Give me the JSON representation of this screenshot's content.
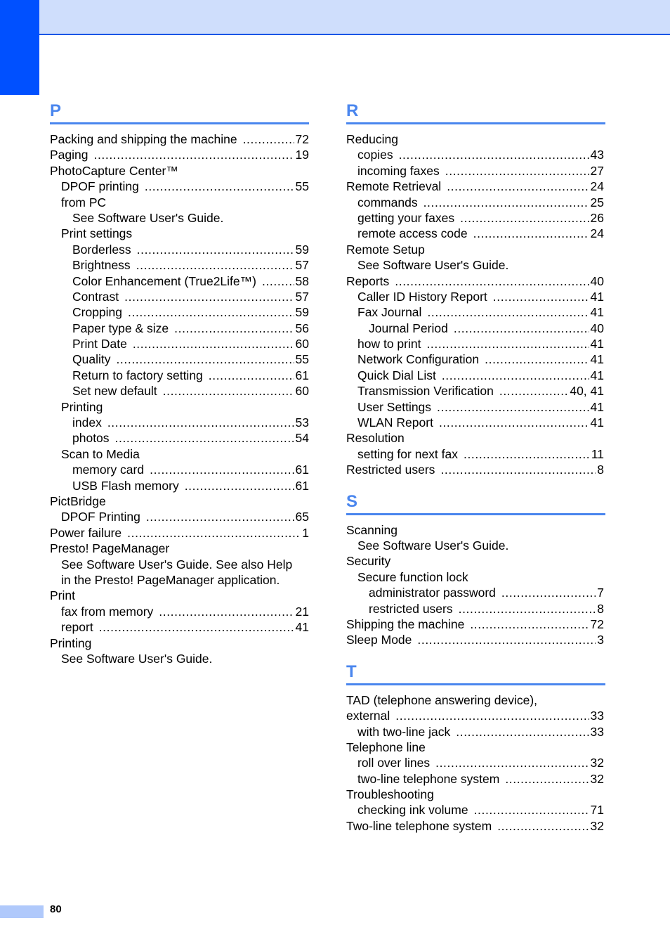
{
  "header": {
    "accent_color": "#0050ff",
    "band_color": "#cfdefc",
    "rule_color": "#4a86ee"
  },
  "columns": [
    {
      "sections": [
        {
          "letter": "P",
          "entries": [
            {
              "level": 0,
              "label": "Packing and shipping the machine",
              "page": "72"
            },
            {
              "level": 0,
              "label": "Paging",
              "page": "19"
            },
            {
              "level": 0,
              "label": "PhotoCapture Center™",
              "page": null
            },
            {
              "level": 1,
              "label": "DPOF printing",
              "page": "55"
            },
            {
              "level": 1,
              "label": "from PC",
              "page": null
            },
            {
              "level": 2,
              "label": "See Software User's Guide.",
              "page": null
            },
            {
              "level": 1,
              "label": "Print settings",
              "page": null
            },
            {
              "level": 2,
              "label": "Borderless",
              "page": "59"
            },
            {
              "level": 2,
              "label": "Brightness",
              "page": "57"
            },
            {
              "level": 2,
              "label": "Color Enhancement (True2Life™)",
              "page": "58"
            },
            {
              "level": 2,
              "label": "Contrast",
              "page": "57"
            },
            {
              "level": 2,
              "label": "Cropping",
              "page": "59"
            },
            {
              "level": 2,
              "label": "Paper type & size",
              "page": "56"
            },
            {
              "level": 2,
              "label": "Print Date",
              "page": "60"
            },
            {
              "level": 2,
              "label": "Quality",
              "page": "55"
            },
            {
              "level": 2,
              "label": "Return to factory setting",
              "page": "61"
            },
            {
              "level": 2,
              "label": "Set new default",
              "page": "60"
            },
            {
              "level": 1,
              "label": "Printing",
              "page": null
            },
            {
              "level": 2,
              "label": "index",
              "page": "53"
            },
            {
              "level": 2,
              "label": "photos",
              "page": "54"
            },
            {
              "level": 1,
              "label": "Scan to Media",
              "page": null
            },
            {
              "level": 2,
              "label": "memory card",
              "page": "61"
            },
            {
              "level": 2,
              "label": "USB Flash memory",
              "page": "61"
            },
            {
              "level": 0,
              "label": "PictBridge",
              "page": null
            },
            {
              "level": 1,
              "label": "DPOF Printing",
              "page": "65"
            },
            {
              "level": 0,
              "label": "Power failure",
              "page": "1"
            },
            {
              "level": 0,
              "label": "Presto! PageManager",
              "page": null
            },
            {
              "level": 1,
              "label": "See Software User's Guide. See also Help",
              "page": null
            },
            {
              "level": 1,
              "label": "in the Presto! PageManager application.",
              "page": null
            },
            {
              "level": 0,
              "label": "Print",
              "page": null
            },
            {
              "level": 1,
              "label": "fax from memory",
              "page": "21"
            },
            {
              "level": 1,
              "label": "report",
              "page": "41"
            },
            {
              "level": 0,
              "label": "Printing",
              "page": null
            },
            {
              "level": 1,
              "label": "See Software User's Guide.",
              "page": null
            }
          ]
        }
      ]
    },
    {
      "sections": [
        {
          "letter": "R",
          "entries": [
            {
              "level": 0,
              "label": "Reducing",
              "page": null
            },
            {
              "level": 1,
              "label": "copies",
              "page": "43"
            },
            {
              "level": 1,
              "label": "incoming faxes",
              "page": "27"
            },
            {
              "level": 0,
              "label": "Remote Retrieval",
              "page": "24"
            },
            {
              "level": 1,
              "label": "commands",
              "page": "25"
            },
            {
              "level": 1,
              "label": "getting your faxes",
              "page": "26"
            },
            {
              "level": 1,
              "label": "remote access code",
              "page": "24"
            },
            {
              "level": 0,
              "label": "Remote Setup",
              "page": null
            },
            {
              "level": 1,
              "label": "See Software User's Guide.",
              "page": null
            },
            {
              "level": 0,
              "label": "Reports",
              "page": "40"
            },
            {
              "level": 1,
              "label": "Caller ID History Report",
              "page": "41"
            },
            {
              "level": 1,
              "label": "Fax Journal",
              "page": "41"
            },
            {
              "level": 2,
              "label": "Journal Period",
              "page": "40"
            },
            {
              "level": 1,
              "label": "how to print",
              "page": "41"
            },
            {
              "level": 1,
              "label": "Network Configuration",
              "page": "41"
            },
            {
              "level": 1,
              "label": "Quick Dial List",
              "page": "41"
            },
            {
              "level": 1,
              "label": "Transmission Verification",
              "page": "40, 41"
            },
            {
              "level": 1,
              "label": "User Settings",
              "page": "41"
            },
            {
              "level": 1,
              "label": "WLAN Report",
              "page": "41"
            },
            {
              "level": 0,
              "label": "Resolution",
              "page": null
            },
            {
              "level": 1,
              "label": "setting for next fax",
              "page": "11"
            },
            {
              "level": 0,
              "label": "Restricted users",
              "page": "8"
            }
          ]
        },
        {
          "letter": "S",
          "entries": [
            {
              "level": 0,
              "label": "Scanning",
              "page": null
            },
            {
              "level": 1,
              "label": "See Software User's Guide.",
              "page": null
            },
            {
              "level": 0,
              "label": "Security",
              "page": null
            },
            {
              "level": 1,
              "label": "Secure function lock",
              "page": null
            },
            {
              "level": 2,
              "label": "administrator password",
              "page": "7"
            },
            {
              "level": 2,
              "label": "restricted users",
              "page": "8"
            },
            {
              "level": 0,
              "label": "Shipping the machine",
              "page": "72"
            },
            {
              "level": 0,
              "label": "Sleep Mode",
              "page": "3"
            }
          ]
        },
        {
          "letter": "T",
          "entries": [
            {
              "level": 0,
              "label": "TAD (telephone answering device),",
              "page": null
            },
            {
              "level": 0,
              "label": "external",
              "page": "33"
            },
            {
              "level": 1,
              "label": "with two-line jack",
              "page": "33"
            },
            {
              "level": 0,
              "label": "Telephone line",
              "page": null
            },
            {
              "level": 1,
              "label": "roll over lines",
              "page": "32"
            },
            {
              "level": 1,
              "label": "two-line telephone system",
              "page": "32"
            },
            {
              "level": 0,
              "label": "Troubleshooting",
              "page": null
            },
            {
              "level": 1,
              "label": "checking ink volume",
              "page": "71"
            },
            {
              "level": 0,
              "label": "Two-line telephone system",
              "page": "32"
            }
          ]
        }
      ]
    }
  ],
  "footer": {
    "page_number": "80"
  }
}
